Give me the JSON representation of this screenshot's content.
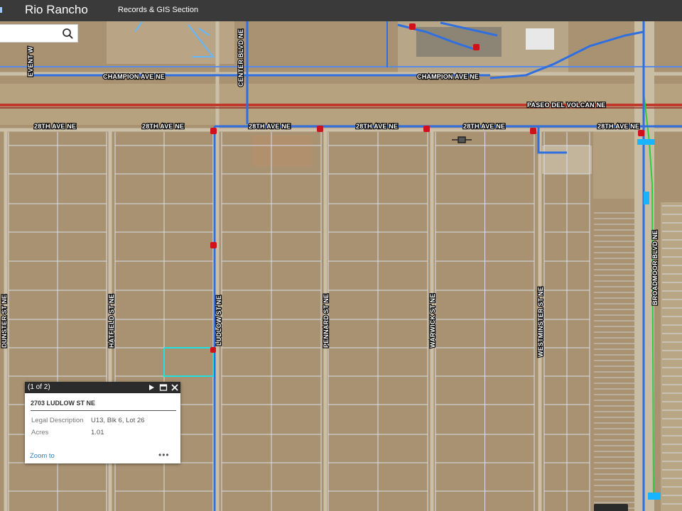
{
  "header": {
    "title": "Rio Rancho",
    "subtitle": "Records & GIS Section",
    "bg_color": "#3a3a3a"
  },
  "search": {
    "placeholder": "",
    "value": "",
    "icon": "search-icon"
  },
  "map": {
    "basemap": "aerial imagery",
    "colors": {
      "ground": "#a89272",
      "parcel_lines": "#d9dde8",
      "water_lines": "#2f6fe0",
      "major_road": "#c0392b",
      "green_line": "#2ecc40",
      "selected_parcel": "#22e0e0",
      "hydrant": "#d0101a"
    },
    "road_labels": {
      "event_way": "EVENT W",
      "center_blvd": "CENTER BLVD NE",
      "champion_1": "CHAMPION AVE NE",
      "champion_2": "CHAMPION AVE NE",
      "paseo": "PASEO DEL VOLCAN NE",
      "ave28_1": "28TH AVE NE",
      "ave28_2": "28TH AVE NE",
      "ave28_3": "28TH AVE NE",
      "ave28_4": "28TH AVE NE",
      "ave28_5": "28TH AVE NE",
      "ave28_6": "28TH AVE NE",
      "dunster": "DUNSTER ST NE",
      "hatfield": "HATFIELD ST NE",
      "ludlow": "LUDLOW ST NE",
      "pennard": "PENNARD ST NE",
      "warwick": "WARWICK ST NE",
      "westminster": "WESTMINSTER ST NE",
      "broadmoor": "BROADMOOR BLVD NE"
    }
  },
  "popup": {
    "pager": "(1 of 2)",
    "title": "2703 LUDLOW ST NE",
    "attributes": [
      {
        "label": "Legal Description",
        "value": "U13, Blk 6, Lot 26"
      },
      {
        "label": "Acres",
        "value": "1.01"
      }
    ],
    "zoom_label": "Zoom to",
    "more_label": "•••",
    "next_icon": "play-icon",
    "maximize_icon": "maximize-icon",
    "close_icon": "close-icon"
  }
}
